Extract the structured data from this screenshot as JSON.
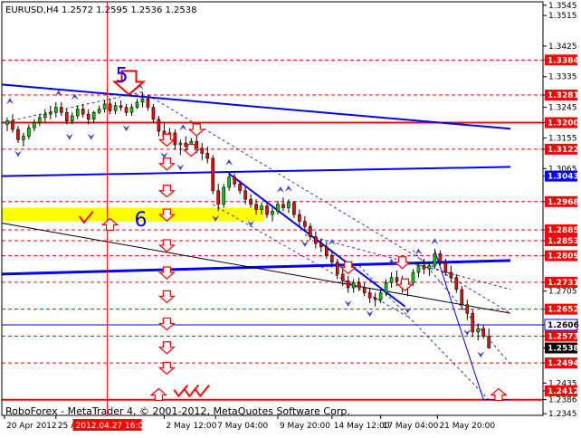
{
  "header": {
    "symbol": "EURUSD,H4",
    "ohlc": "1.2572 1.2595 1.2536 1.2538"
  },
  "footer": {
    "copyright": "RoboForex - MetaTrader 4, © 2001-2012, MetaQuotes Software Corp."
  },
  "wave_labels": {
    "five": "5",
    "six": "6"
  },
  "colors": {
    "level_line": "#ff0000",
    "trend_line": "#0000ff",
    "price_marker": "#000000",
    "highlight_zone": "#ffff00",
    "arrow": "#ff0000",
    "fractal": "#4444cc",
    "candle": "#000000",
    "bull_body": "#00cc00",
    "bear_body": "#ff0000"
  },
  "chart_data": {
    "type": "candlestick",
    "symbol": "EURUSD",
    "timeframe": "H4",
    "ylim": [
      1.234,
      1.3555
    ],
    "y_ticks": [
      "1.3545",
      "1.3515",
      "1.3425",
      "1.3384",
      "1.3335",
      "1.3281",
      "1.3245",
      "1.3200",
      "1.3155",
      "1.3122",
      "1.3065",
      "1.3043",
      "1.2968",
      "1.2885",
      "1.2853",
      "1.2809",
      "1.2731",
      "1.2705",
      "1.2652",
      "1.2606",
      "1.2573",
      "1.2538",
      "1.2494",
      "1.2435",
      "1.2412",
      "1.2386",
      "1.2345"
    ],
    "x_ticks": [
      "20 Apr 2012",
      "25 A",
      "2 May 12:00",
      "7 May 04:00",
      "9 May 20:00",
      "14 May 12:00",
      "17 May 04:00",
      "21 May 20:00"
    ],
    "x_tick_pos": [
      0.005,
      0.1,
      0.3,
      0.395,
      0.51,
      0.61,
      0.7,
      0.805
    ],
    "crosshair_label": "2012.04.27 16:00",
    "crosshair_x": 0.195,
    "highlighted_levels": [
      {
        "value": 1.32,
        "style": "red"
      },
      {
        "value": 1.3043,
        "style": "blue"
      },
      {
        "value": 1.2606,
        "style": "blue-outline"
      },
      {
        "value": 1.2538,
        "style": "black"
      },
      {
        "value": 1.2412,
        "style": "red"
      }
    ],
    "dashed_levels": [
      1.3384,
      1.3281,
      1.3122,
      1.2968,
      1.2885,
      1.2853,
      1.2809,
      1.2731,
      1.2652,
      1.2573,
      1.2494
    ],
    "solid_levels": [
      1.32,
      1.2386
    ],
    "trend_lines": [
      {
        "from": [
          0.0,
          1.3312
        ],
        "to": [
          0.94,
          1.3182
        ],
        "color": "blue",
        "width": 2
      },
      {
        "from": [
          0.0,
          1.3043
        ],
        "to": [
          0.94,
          1.307
        ],
        "color": "blue",
        "width": 2
      },
      {
        "from": [
          0.0,
          1.2755
        ],
        "to": [
          0.94,
          1.2795
        ],
        "color": "blue",
        "width": 3
      },
      {
        "from": [
          0.0,
          1.2905
        ],
        "to": [
          0.94,
          1.264
        ],
        "color": "black",
        "width": 1
      },
      {
        "from": [
          0.42,
          1.305
        ],
        "to": [
          0.745,
          1.266
        ],
        "color": "blue",
        "width": 2
      },
      {
        "from": [
          0.8,
          1.2825
        ],
        "to": [
          0.89,
          1.2386
        ],
        "color": "blue",
        "width": 1
      },
      {
        "from": [
          0.89,
          1.2386
        ],
        "to": [
          0.94,
          1.2386
        ],
        "color": "blue",
        "width": 1
      }
    ],
    "dashed_trend_lines": [
      {
        "from": [
          0.0,
          1.32
        ],
        "to": [
          0.26,
          1.329
        ]
      },
      {
        "from": [
          0.27,
          1.3281
        ],
        "to": [
          0.94,
          1.264
        ]
      },
      {
        "from": [
          0.39,
          1.296
        ],
        "to": [
          0.75,
          1.263
        ]
      },
      {
        "from": [
          0.56,
          1.287
        ],
        "to": [
          0.94,
          1.271
        ]
      },
      {
        "from": [
          0.76,
          1.2825
        ],
        "to": [
          0.94,
          1.249
        ]
      },
      {
        "from": [
          0.66,
          1.278
        ],
        "to": [
          0.9,
          1.2386
        ]
      }
    ],
    "yellow_zone": {
      "x_from": 0.0,
      "x_to": 0.485,
      "y_top": 1.295,
      "y_bottom": 1.291
    },
    "candles": [
      [
        0.01,
        1.3195,
        1.3215,
        1.3175,
        1.3205
      ],
      [
        0.02,
        1.3205,
        1.3225,
        1.317,
        1.318
      ],
      [
        0.03,
        1.318,
        1.319,
        1.314,
        1.315
      ],
      [
        0.04,
        1.315,
        1.317,
        1.313,
        1.316
      ],
      [
        0.05,
        1.316,
        1.3195,
        1.315,
        1.3185
      ],
      [
        0.06,
        1.3185,
        1.321,
        1.3175,
        1.32
      ],
      [
        0.07,
        1.32,
        1.3225,
        1.319,
        1.3215
      ],
      [
        0.08,
        1.3215,
        1.324,
        1.32,
        1.3225
      ],
      [
        0.09,
        1.3225,
        1.325,
        1.321,
        1.323
      ],
      [
        0.1,
        1.323,
        1.326,
        1.3215,
        1.3245
      ],
      [
        0.11,
        1.3245,
        1.326,
        1.322,
        1.323
      ],
      [
        0.12,
        1.323,
        1.324,
        1.3195,
        1.3205
      ],
      [
        0.13,
        1.3205,
        1.323,
        1.3195,
        1.322
      ],
      [
        0.14,
        1.322,
        1.325,
        1.321,
        1.324
      ],
      [
        0.15,
        1.324,
        1.3255,
        1.3215,
        1.3225
      ],
      [
        0.16,
        1.3225,
        1.324,
        1.3195,
        1.321
      ],
      [
        0.17,
        1.321,
        1.3235,
        1.32,
        1.323
      ],
      [
        0.18,
        1.323,
        1.325,
        1.3225,
        1.324
      ],
      [
        0.19,
        1.324,
        1.3265,
        1.323,
        1.3255
      ],
      [
        0.2,
        1.3255,
        1.327,
        1.3225,
        1.3235
      ],
      [
        0.21,
        1.3235,
        1.326,
        1.3225,
        1.325
      ],
      [
        0.22,
        1.325,
        1.3265,
        1.3235,
        1.3245
      ],
      [
        0.23,
        1.3245,
        1.3255,
        1.322,
        1.323
      ],
      [
        0.24,
        1.323,
        1.3255,
        1.322,
        1.3245
      ],
      [
        0.25,
        1.3245,
        1.327,
        1.324,
        1.326
      ],
      [
        0.26,
        1.326,
        1.329,
        1.3245,
        1.327
      ],
      [
        0.27,
        1.327,
        1.3281,
        1.3235,
        1.3245
      ],
      [
        0.28,
        1.3245,
        1.3255,
        1.32,
        1.321
      ],
      [
        0.29,
        1.321,
        1.322,
        1.316,
        1.3175
      ],
      [
        0.3,
        1.3175,
        1.32,
        1.314,
        1.316
      ],
      [
        0.31,
        1.316,
        1.3185,
        1.314,
        1.317
      ],
      [
        0.32,
        1.317,
        1.318,
        1.312,
        1.3135
      ],
      [
        0.33,
        1.3135,
        1.315,
        1.3105,
        1.314
      ],
      [
        0.34,
        1.314,
        1.316,
        1.312,
        1.313
      ],
      [
        0.35,
        1.313,
        1.3155,
        1.3115,
        1.3145
      ],
      [
        0.36,
        1.3145,
        1.316,
        1.311,
        1.3125
      ],
      [
        0.37,
        1.3125,
        1.314,
        1.309,
        1.311
      ],
      [
        0.38,
        1.311,
        1.313,
        1.308,
        1.3095
      ],
      [
        0.39,
        1.3095,
        1.3105,
        1.299,
        1.3
      ],
      [
        0.4,
        1.3,
        1.302,
        1.294,
        1.296
      ],
      [
        0.41,
        1.296,
        1.302,
        1.295,
        1.301
      ],
      [
        0.42,
        1.301,
        1.3055,
        1.3,
        1.304
      ],
      [
        0.43,
        1.304,
        1.305,
        1.301,
        1.302
      ],
      [
        0.44,
        1.302,
        1.303,
        1.299,
        1.3
      ],
      [
        0.45,
        1.3,
        1.301,
        1.296,
        1.2975
      ],
      [
        0.46,
        1.2975,
        1.299,
        1.295,
        1.296
      ],
      [
        0.47,
        1.296,
        1.2975,
        1.293,
        1.2945
      ],
      [
        0.48,
        1.2945,
        1.2965,
        1.293,
        1.2955
      ],
      [
        0.49,
        1.2955,
        1.2965,
        1.292,
        1.293
      ],
      [
        0.5,
        1.293,
        1.295,
        1.291,
        1.294
      ],
      [
        0.51,
        1.294,
        1.297,
        1.293,
        1.296
      ],
      [
        0.52,
        1.296,
        1.298,
        1.294,
        1.295
      ],
      [
        0.53,
        1.295,
        1.2975,
        1.2935,
        1.2965
      ],
      [
        0.54,
        1.2965,
        1.297,
        1.292,
        1.293
      ],
      [
        0.55,
        1.293,
        1.2945,
        1.2895,
        1.291
      ],
      [
        0.56,
        1.291,
        1.2925,
        1.288,
        1.2895
      ],
      [
        0.57,
        1.2895,
        1.2905,
        1.2855,
        1.2865
      ],
      [
        0.58,
        1.2865,
        1.288,
        1.283,
        1.2845
      ],
      [
        0.59,
        1.2845,
        1.286,
        1.282,
        1.2835
      ],
      [
        0.6,
        1.2835,
        1.285,
        1.28,
        1.281
      ],
      [
        0.61,
        1.281,
        1.2825,
        1.2775,
        1.279
      ],
      [
        0.62,
        1.279,
        1.28,
        1.274,
        1.2755
      ],
      [
        0.63,
        1.2755,
        1.277,
        1.272,
        1.2735
      ],
      [
        0.64,
        1.2735,
        1.275,
        1.27,
        1.2715
      ],
      [
        0.65,
        1.2715,
        1.274,
        1.27,
        1.273
      ],
      [
        0.66,
        1.273,
        1.2745,
        1.2705,
        1.2715
      ],
      [
        0.67,
        1.2715,
        1.273,
        1.269,
        1.27
      ],
      [
        0.68,
        1.27,
        1.2715,
        1.267,
        1.2685
      ],
      [
        0.69,
        1.2685,
        1.27,
        1.266,
        1.268
      ],
      [
        0.7,
        1.268,
        1.271,
        1.267,
        1.27
      ],
      [
        0.71,
        1.27,
        1.274,
        1.269,
        1.273
      ],
      [
        0.72,
        1.273,
        1.276,
        1.2715,
        1.2745
      ],
      [
        0.73,
        1.2745,
        1.2765,
        1.272,
        1.2735
      ],
      [
        0.74,
        1.2735,
        1.275,
        1.27,
        1.2715
      ],
      [
        0.75,
        1.2715,
        1.274,
        1.269,
        1.273
      ],
      [
        0.76,
        1.273,
        1.277,
        1.272,
        1.276
      ],
      [
        0.77,
        1.276,
        1.279,
        1.2745,
        1.278
      ],
      [
        0.78,
        1.278,
        1.28,
        1.2755,
        1.277
      ],
      [
        0.79,
        1.277,
        1.279,
        1.275,
        1.278
      ],
      [
        0.8,
        1.278,
        1.283,
        1.277,
        1.2815
      ],
      [
        0.81,
        1.2815,
        1.2825,
        1.278,
        1.279
      ],
      [
        0.82,
        1.279,
        1.28,
        1.275,
        1.276
      ],
      [
        0.83,
        1.276,
        1.278,
        1.273,
        1.2745
      ],
      [
        0.84,
        1.2745,
        1.2755,
        1.27,
        1.271
      ],
      [
        0.85,
        1.271,
        1.272,
        1.265,
        1.2665
      ],
      [
        0.86,
        1.2665,
        1.268,
        1.262,
        1.264
      ],
      [
        0.87,
        1.264,
        1.265,
        1.257,
        1.2585
      ],
      [
        0.88,
        1.2585,
        1.261,
        1.256,
        1.2595
      ],
      [
        0.89,
        1.2595,
        1.2605,
        1.2565,
        1.2572
      ],
      [
        0.9,
        1.2572,
        1.2595,
        1.2536,
        1.2538
      ]
    ],
    "fractals_up": [
      [
        0.015,
        1.3262
      ],
      [
        0.105,
        1.3285
      ],
      [
        0.135,
        1.3275
      ],
      [
        0.255,
        1.3305
      ],
      [
        0.335,
        1.3185
      ],
      [
        0.42,
        1.3082
      ],
      [
        0.515,
        1.3002
      ],
      [
        0.53,
        1.3005
      ],
      [
        0.61,
        1.2848
      ],
      [
        0.72,
        1.279
      ],
      [
        0.77,
        1.282
      ],
      [
        0.8,
        1.285
      ]
    ],
    "fractals_down": [
      [
        0.03,
        1.311
      ],
      [
        0.125,
        1.316
      ],
      [
        0.165,
        1.316
      ],
      [
        0.23,
        1.3185
      ],
      [
        0.3,
        1.3105
      ],
      [
        0.33,
        1.307
      ],
      [
        0.395,
        1.292
      ],
      [
        0.46,
        1.2905
      ],
      [
        0.56,
        1.2845
      ],
      [
        0.64,
        1.267
      ],
      [
        0.68,
        1.264
      ],
      [
        0.75,
        1.265
      ],
      [
        0.86,
        1.2585
      ],
      [
        0.885,
        1.252
      ]
    ],
    "arrows_down": [
      [
        0.235,
        1.332,
        "big"
      ],
      [
        0.305,
        1.315,
        "small"
      ],
      [
        0.305,
        1.308,
        "small"
      ],
      [
        0.305,
        1.3,
        "small"
      ],
      [
        0.305,
        1.293,
        "small"
      ],
      [
        0.305,
        1.284,
        "small"
      ],
      [
        0.305,
        1.276,
        "small"
      ],
      [
        0.305,
        1.269,
        "small"
      ],
      [
        0.305,
        1.261,
        "small"
      ],
      [
        0.305,
        1.254,
        "small"
      ],
      [
        0.305,
        1.248,
        "small"
      ],
      [
        0.36,
        1.318,
        "small"
      ],
      [
        0.35,
        1.312,
        "small"
      ],
      [
        0.74,
        1.279,
        "small"
      ],
      [
        0.64,
        1.2775,
        "small"
      ],
      [
        0.745,
        1.2725,
        "small"
      ]
    ],
    "arrows_up": [
      [
        0.2,
        1.29
      ],
      [
        0.29,
        1.24
      ],
      [
        0.918,
        1.24
      ]
    ],
    "checkmarks": [
      [
        0.155,
        1.292
      ],
      [
        0.33,
        1.241
      ],
      [
        0.35,
        1.241
      ],
      [
        0.37,
        1.241
      ]
    ],
    "wave_label_pos": {
      "five": [
        0.21,
        1.332
      ],
      "six": [
        0.245,
        1.2895
      ]
    }
  }
}
